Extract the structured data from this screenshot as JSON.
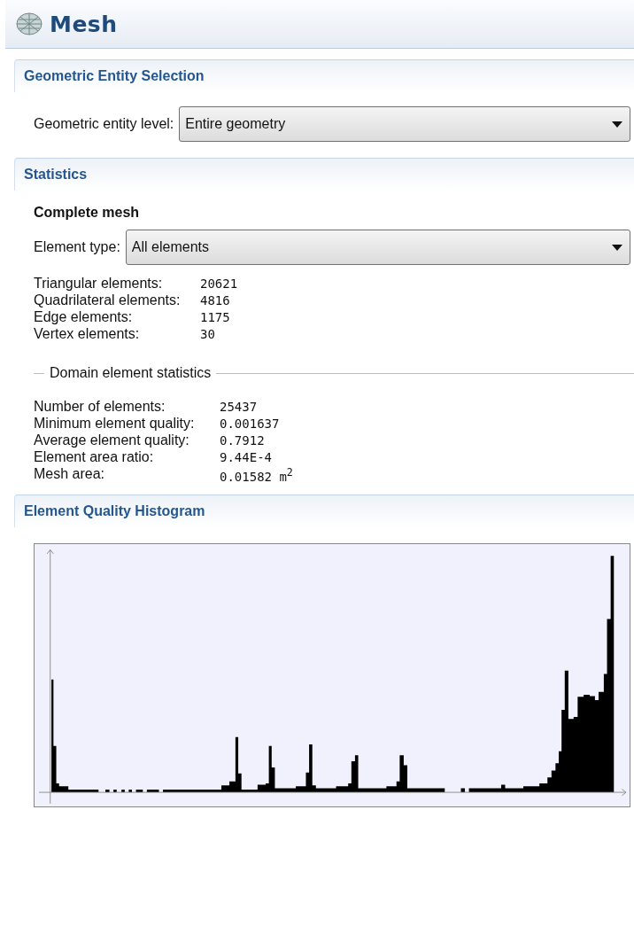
{
  "window": {
    "title": "Mesh"
  },
  "sections": [
    {
      "title": "Geometric Entity Selection",
      "kind": "selection",
      "field": {
        "label": "Geometric entity level:",
        "value": "Entire geometry"
      }
    },
    {
      "title": "Statistics",
      "kind": "statistics",
      "subtitle": "Complete mesh",
      "field": {
        "label": "Element type:",
        "value": "All elements"
      },
      "counts": [
        {
          "label": "Triangular elements:",
          "value": "20621"
        },
        {
          "label": "Quadrilateral elements:",
          "value": "4816"
        },
        {
          "label": "Edge elements:",
          "value": "1175"
        },
        {
          "label": "Vertex elements:",
          "value": "30"
        }
      ],
      "group": {
        "title": "Domain element statistics",
        "rows": [
          {
            "label": "Number of elements:",
            "value": "25437"
          },
          {
            "label": "Minimum element quality:",
            "value": "0.001637"
          },
          {
            "label": "Average element quality:",
            "value": "0.7912"
          },
          {
            "label": "Element area ratio:",
            "value": "9.44E-4"
          },
          {
            "label": "Mesh area:",
            "value": "0.01582 m$^{2}$"
          }
        ]
      }
    },
    {
      "title": "Element Quality Histogram",
      "kind": "histogram"
    }
  ]
}
